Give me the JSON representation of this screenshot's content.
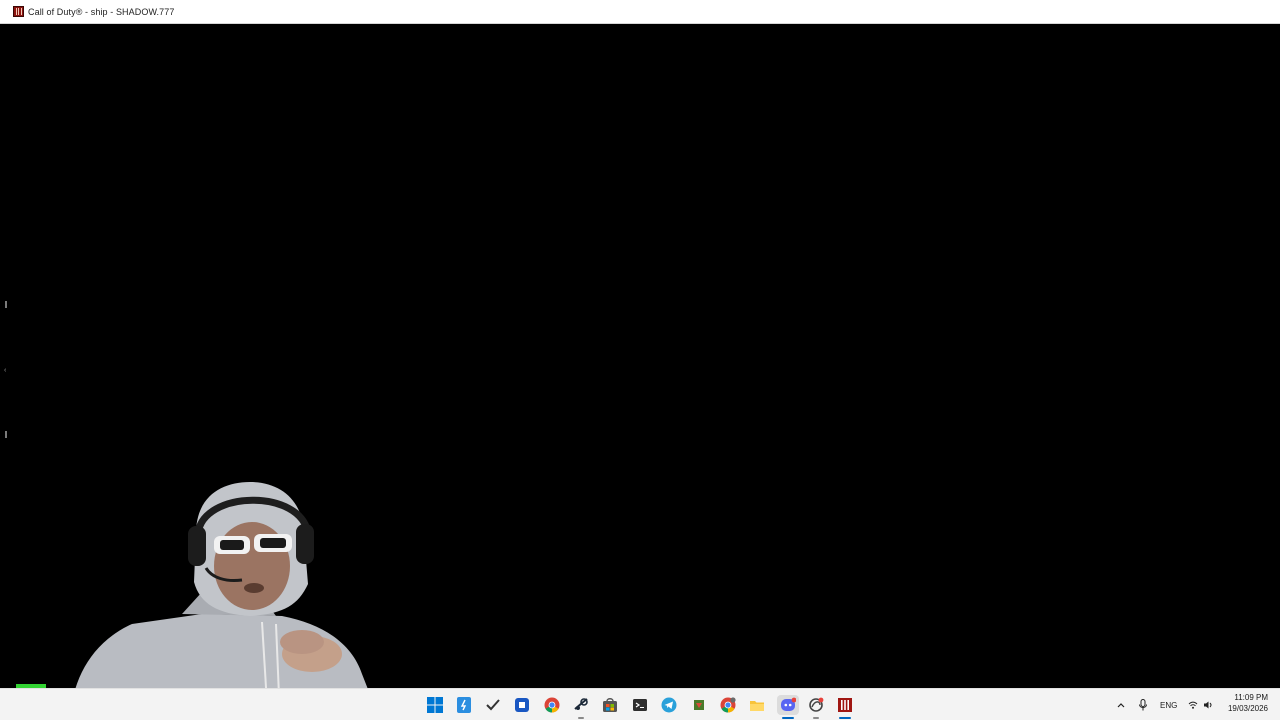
{
  "window": {
    "title": "Call of Duty®  - ship - SHADOW.777",
    "app_icon": "call-of-duty-icon"
  },
  "overlay": {
    "webcam": "streamer-webcam",
    "indicator_color": "#33d433"
  },
  "taskbar": {
    "pinned": [
      {
        "name": "start-icon"
      },
      {
        "name": "file-explorer-blue-icon"
      },
      {
        "name": "checkmark-app-icon"
      },
      {
        "name": "snipping-tool-icon"
      },
      {
        "name": "chrome-icon"
      },
      {
        "name": "steam-icon"
      },
      {
        "name": "microsoft-store-icon"
      },
      {
        "name": "terminal-icon"
      },
      {
        "name": "telegram-icon"
      },
      {
        "name": "gpu-app-icon"
      },
      {
        "name": "chrome-profile-icon"
      },
      {
        "name": "file-explorer-icon"
      },
      {
        "name": "discord-icon"
      },
      {
        "name": "battle-net-icon"
      },
      {
        "name": "call-of-duty-taskbar-icon"
      }
    ],
    "tray": {
      "language": "ENG",
      "time": "11:09 PM",
      "date": "19/03/2026"
    }
  },
  "colors": {
    "taskbar_bg": "#f3f3f3",
    "accent": "#0067c0",
    "viewport_bg": "#000000"
  }
}
